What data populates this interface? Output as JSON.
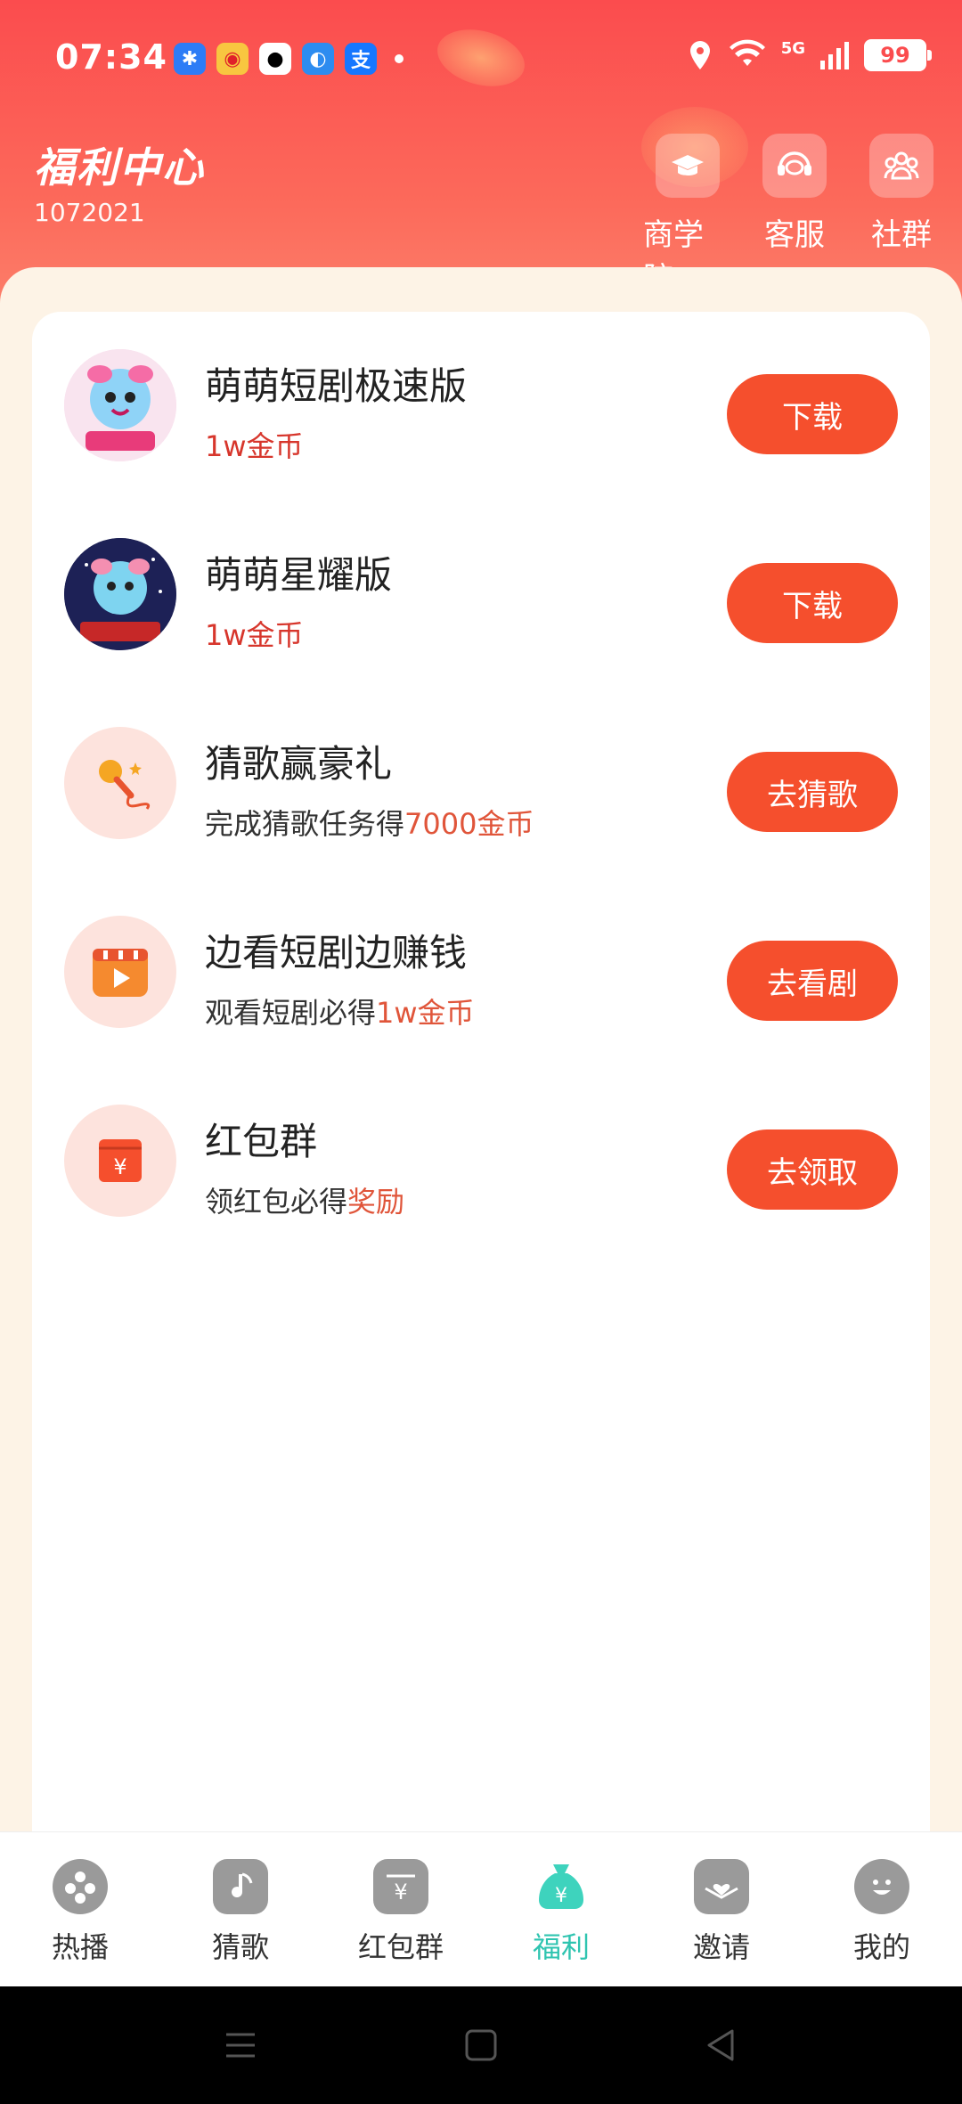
{
  "status_bar": {
    "time": "07:34",
    "battery": "99",
    "network": "5G"
  },
  "header": {
    "title": "福利中心",
    "user_id": "1072021",
    "buttons": [
      {
        "label": "商学院",
        "icon": "graduation-cap-icon"
      },
      {
        "label": "客服",
        "icon": "headset-icon"
      },
      {
        "label": "社群",
        "icon": "group-icon"
      }
    ]
  },
  "tasks": [
    {
      "title": "萌萌短剧极速版",
      "reward": "1w金币",
      "button": "下载",
      "icon": "app-mascot-icon"
    },
    {
      "title": "萌萌星耀版",
      "reward": "1w金币",
      "button": "下载",
      "icon": "app-mascot-star-icon"
    },
    {
      "title": "猜歌赢豪礼",
      "desc_prefix": "完成猜歌任务得",
      "desc_highlight": "7000金币",
      "button": "去猜歌",
      "icon": "microphone-icon"
    },
    {
      "title": "边看短剧边赚钱",
      "desc_prefix": "观看短剧必得",
      "desc_highlight": "1w金币",
      "button": "去看剧",
      "icon": "video-play-icon"
    },
    {
      "title": "红包群",
      "desc_prefix": "领红包必得",
      "desc_highlight": "奖励",
      "button": "去领取",
      "icon": "red-envelope-icon"
    }
  ],
  "bottom_nav": [
    {
      "label": "热播",
      "icon": "film-reel-icon"
    },
    {
      "label": "猜歌",
      "icon": "music-note-icon"
    },
    {
      "label": "红包群",
      "icon": "yuan-envelope-icon"
    },
    {
      "label": "福利",
      "icon": "money-bag-icon",
      "active": true
    },
    {
      "label": "邀请",
      "icon": "invite-heart-icon"
    },
    {
      "label": "我的",
      "icon": "smile-face-icon"
    }
  ],
  "colors": {
    "header": "#fb4c4e",
    "button": "#f54f2d",
    "highlight": "#e0553a",
    "active_nav": "#2ec4b0"
  }
}
